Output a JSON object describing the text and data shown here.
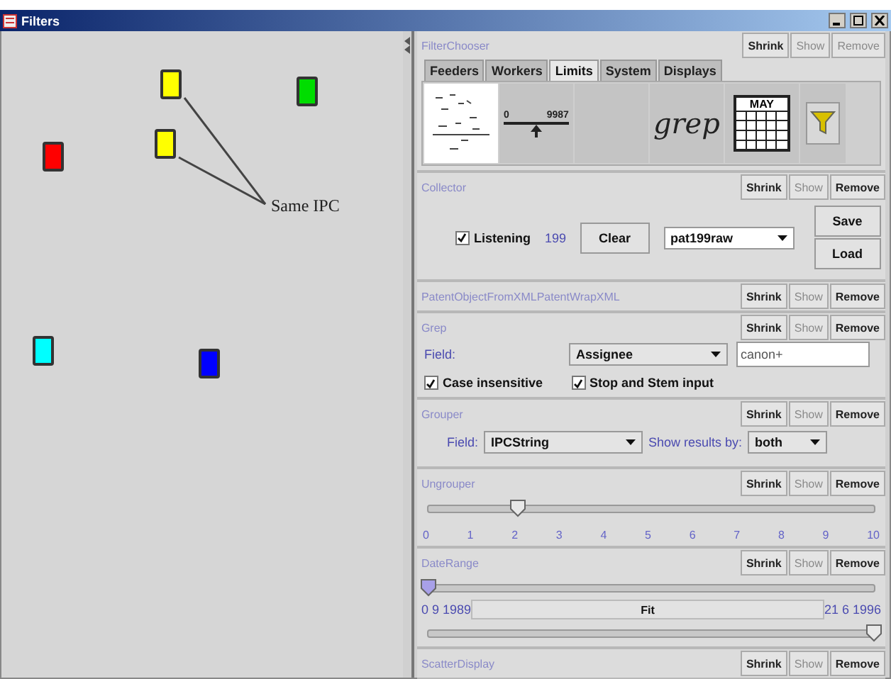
{
  "window": {
    "title": "Filters"
  },
  "canvas": {
    "markers": [
      {
        "color": "#ffff00"
      },
      {
        "color": "#00dd00"
      },
      {
        "color": "#ff0000"
      },
      {
        "color": "#ffff00"
      },
      {
        "color": "#00ffff"
      },
      {
        "color": "#0000ff"
      }
    ],
    "annotation": {
      "text": "Same IPC"
    }
  },
  "panels": [
    {
      "kind": "chooser",
      "title": "FilterChooser",
      "buttons": [
        {
          "label": "Shrink",
          "disabled": false
        },
        {
          "label": "Show",
          "disabled": true
        },
        {
          "label": "Remove",
          "disabled": true
        }
      ],
      "tabs": [
        {
          "label": "Feeders",
          "selected": false
        },
        {
          "label": "Workers",
          "selected": false
        },
        {
          "label": "Limits",
          "selected": true
        },
        {
          "label": "System",
          "selected": false
        },
        {
          "label": "Displays",
          "selected": false
        }
      ],
      "tiles": [
        {
          "kind": "scatter",
          "selected": true
        },
        {
          "kind": "range",
          "selected": false,
          "low": "0",
          "high": "9987"
        },
        {
          "kind": "blank",
          "selected": false
        },
        {
          "kind": "grep",
          "selected": false,
          "text": "grep"
        },
        {
          "kind": "calendar",
          "selected": false,
          "text": "MAY"
        },
        {
          "kind": "funnel",
          "selected": false
        }
      ]
    },
    {
      "kind": "collector",
      "title": "Collector",
      "buttons": [
        {
          "label": "Shrink",
          "disabled": false
        },
        {
          "label": "Show",
          "disabled": true
        },
        {
          "label": "Remove",
          "disabled": false
        }
      ],
      "listening": {
        "label": "Listening",
        "checked": true
      },
      "count": "199",
      "clear": "Clear",
      "source": "pat199raw",
      "save": "Save",
      "load": "Load"
    },
    {
      "kind": "plain",
      "title": "PatentObjectFromXMLPatentWrapXML",
      "buttons": [
        {
          "label": "Shrink",
          "disabled": false
        },
        {
          "label": "Show",
          "disabled": true
        },
        {
          "label": "Remove",
          "disabled": false
        }
      ]
    },
    {
      "kind": "grep",
      "title": "Grep",
      "buttons": [
        {
          "label": "Shrink",
          "disabled": false
        },
        {
          "label": "Show",
          "disabled": true
        },
        {
          "label": "Remove",
          "disabled": false
        }
      ],
      "field_label": "Field:",
      "field": "Assignee",
      "query": "canon+",
      "options": [
        {
          "label": "Case insensitive",
          "checked": true
        },
        {
          "label": "Stop and Stem input",
          "checked": true
        }
      ]
    },
    {
      "kind": "grouper",
      "title": "Grouper",
      "buttons": [
        {
          "label": "Shrink",
          "disabled": false
        },
        {
          "label": "Show",
          "disabled": true
        },
        {
          "label": "Remove",
          "disabled": false
        }
      ],
      "field_label": "Field:",
      "field": "IPCString",
      "show_label": "Show results by:",
      "show": "both"
    },
    {
      "kind": "slider",
      "title": "Ungrouper",
      "buttons": [
        {
          "label": "Shrink",
          "disabled": false
        },
        {
          "label": "Show",
          "disabled": true
        },
        {
          "label": "Remove",
          "disabled": false
        }
      ],
      "level": 0.2,
      "ticks": [
        "0",
        "1",
        "2",
        "3",
        "4",
        "5",
        "6",
        "7",
        "8",
        "9",
        "10"
      ]
    },
    {
      "kind": "daterange",
      "title": "DateRange",
      "buttons": [
        {
          "label": "Shrink",
          "disabled": false
        },
        {
          "label": "Show",
          "disabled": true
        },
        {
          "label": "Remove",
          "disabled": false
        }
      ],
      "start": {
        "level": 0
      },
      "end": {
        "level": 1
      },
      "from": "0 9 1989",
      "fit": "Fit",
      "to": "21 6 1996"
    },
    {
      "kind": "plain",
      "title": "ScatterDisplay",
      "buttons": [
        {
          "label": "Shrink",
          "disabled": false
        },
        {
          "label": "Show",
          "disabled": true
        },
        {
          "label": "Remove",
          "disabled": false
        }
      ]
    }
  ]
}
